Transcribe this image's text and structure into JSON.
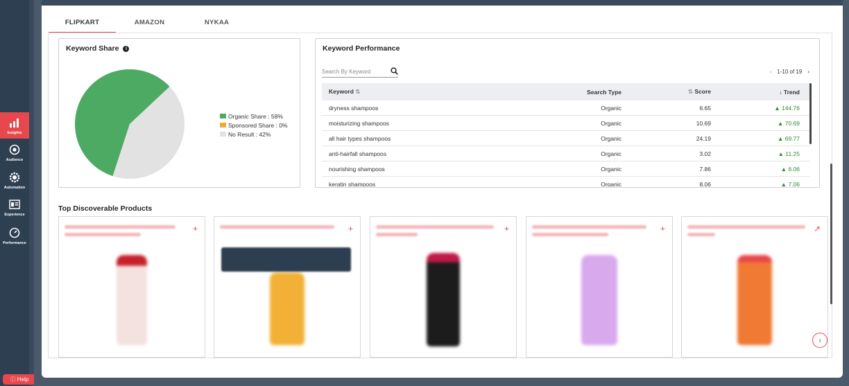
{
  "sidebar": {
    "items": [
      {
        "label": "Insights",
        "icon": "bar-chart-icon",
        "active": true
      },
      {
        "label": "Audience",
        "icon": "target-icon",
        "active": false
      },
      {
        "label": "Automation",
        "icon": "gear-icon",
        "active": false
      },
      {
        "label": "Experience",
        "icon": "layout-icon",
        "active": false
      },
      {
        "label": "Performance",
        "icon": "gauge-icon",
        "active": false
      }
    ],
    "help_label": "Help"
  },
  "tabs": [
    {
      "label": "FLIPKART",
      "active": true
    },
    {
      "label": "AMAZON",
      "active": false
    },
    {
      "label": "NYKAA",
      "active": false
    }
  ],
  "keyword_share": {
    "title": "Keyword Share",
    "legend": [
      {
        "label": "Organic Share : 58%",
        "color": "#4caa62"
      },
      {
        "label": "Sponsored Share : 0%",
        "color": "#f2a93b"
      },
      {
        "label": "No Result : 42%",
        "color": "#e2e2e2"
      }
    ]
  },
  "chart_data": {
    "type": "pie",
    "title": "Keyword Share",
    "slices": [
      {
        "label": "Organic Share",
        "value": 58,
        "color": "#4caa62"
      },
      {
        "label": "Sponsored Share",
        "value": 0,
        "color": "#f2a93b"
      },
      {
        "label": "No Result",
        "value": 42,
        "color": "#e2e2e2"
      }
    ]
  },
  "keyword_performance": {
    "title": "Keyword Performance",
    "search_placeholder": "Search By Keyword",
    "pagination": "1-10 of 19",
    "columns": {
      "keyword": "Keyword",
      "search_type": "Search Type",
      "score": "Score",
      "trend": "Trend"
    },
    "rows": [
      {
        "keyword": "dryness shampoos",
        "search_type": "Organic",
        "score": "6.65",
        "trend": "144.76"
      },
      {
        "keyword": "moisturizing shampoos",
        "search_type": "Organic",
        "score": "10.69",
        "trend": "70.69"
      },
      {
        "keyword": "all hair types shampoos",
        "search_type": "Organic",
        "score": "24.19",
        "trend": "69.77"
      },
      {
        "keyword": "anti-hairfall shampoos",
        "search_type": "Organic",
        "score": "3.02",
        "trend": "11.25"
      },
      {
        "keyword": "nourishing shampoos",
        "search_type": "Organic",
        "score": "7.86",
        "trend": "6.06"
      },
      {
        "keyword": "keratin shampoos",
        "search_type": "Organic",
        "score": "8.06",
        "trend": "7.06"
      }
    ]
  },
  "products": {
    "title": "Top Discoverable Products",
    "items": [
      {
        "bottle_color": "#f3e2e0",
        "cap_color": "#c8202a"
      },
      {
        "bottle_color": "#f2b136",
        "cap_color": "#e9b04a"
      },
      {
        "bottle_color": "#1c1c1c",
        "cap_color": "#c01a4a"
      },
      {
        "bottle_color": "#d9a9ee",
        "cap_color": "#c9a3e6"
      },
      {
        "bottle_color": "#f07a33",
        "cap_color": "#e8474b"
      }
    ]
  }
}
